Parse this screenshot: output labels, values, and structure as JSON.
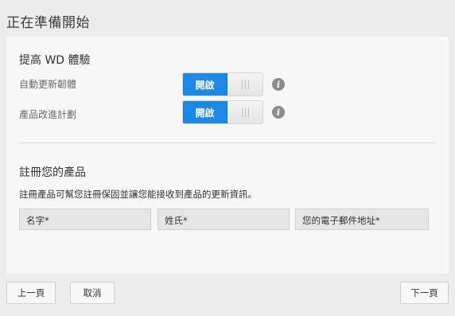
{
  "header": {
    "title": "正在準備開始"
  },
  "improve": {
    "title": "提高 WD 體驗",
    "rows": [
      {
        "label": "自動更新韌體",
        "toggle": "開啟",
        "enabled": true,
        "info_icon": "info-icon"
      },
      {
        "label": "產品改進計劃",
        "toggle": "開啟",
        "enabled": true,
        "info_icon": "info-icon"
      }
    ]
  },
  "register": {
    "title": "註冊您的產品",
    "description": "註冊產品可幫您註冊保固並讓您能接收到產品的更新資訊。",
    "fields": {
      "first_name": "名字*",
      "last_name": "姓氏*",
      "email": "您的電子郵件地址*"
    }
  },
  "footer": {
    "back": "上一頁",
    "cancel": "取消",
    "next": "下一頁"
  },
  "colors": {
    "accent": "#1e88e5",
    "background": "#ececec",
    "panel": "#f7f7f7"
  }
}
